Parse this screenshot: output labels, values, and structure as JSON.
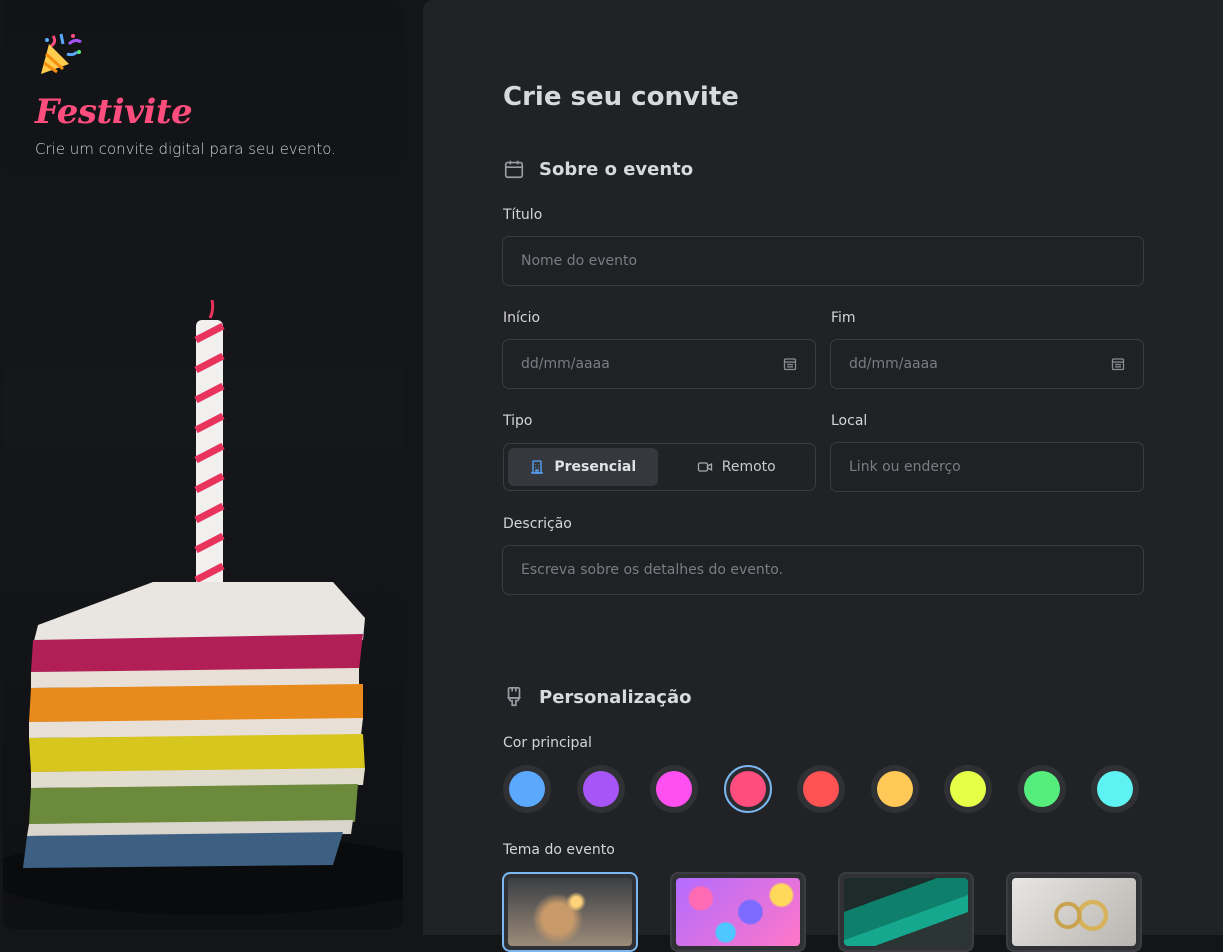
{
  "brand": {
    "name": "Festivite",
    "tagline": "Crie um convite digital para seu evento."
  },
  "form": {
    "title": "Crie seu convite",
    "about_section": {
      "title": "Sobre o evento",
      "icon": "calendar-icon",
      "titulo_label": "Título",
      "titulo_placeholder": "Nome do evento",
      "inicio_label": "Início",
      "inicio_placeholder": "dd/mm/aaaa",
      "fim_label": "Fim",
      "fim_placeholder": "dd/mm/aaaa",
      "tipo_label": "Tipo",
      "tipo_options": [
        "Presencial",
        "Remoto"
      ],
      "tipo_selected": "Presencial",
      "local_label": "Local",
      "local_placeholder": "Link ou enderço",
      "descricao_label": "Descrição",
      "descricao_placeholder": "Escreva sobre os detalhes do evento."
    },
    "custom_section": {
      "title": "Personalização",
      "icon": "paintbrush-icon",
      "color_label": "Cor principal",
      "colors": [
        "#5aa9ff",
        "#a855f7",
        "#ff4ff0",
        "#ff4d7e",
        "#ff5252",
        "#ffc857",
        "#e6ff47",
        "#55ee7d",
        "#5ef2f2"
      ],
      "selected_color": "#ff4d7e",
      "theme_label": "Tema do evento",
      "themes": [
        "birthday",
        "party",
        "graduation",
        "wedding"
      ],
      "selected_theme": "birthday"
    }
  }
}
